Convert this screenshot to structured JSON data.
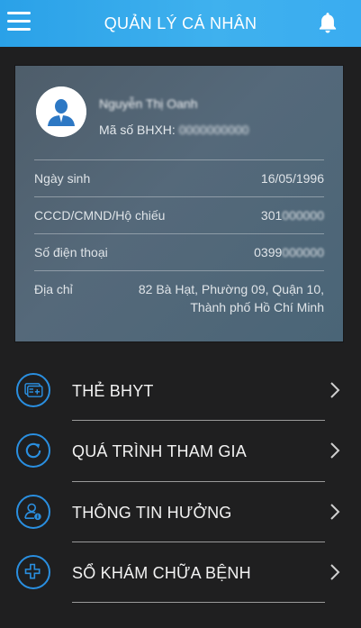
{
  "header": {
    "title": "QUẢN LÝ CÁ NHÂN",
    "menu_icon": "hamburger-icon",
    "bell_icon": "bell-icon",
    "bg": "#3aacf0"
  },
  "profile": {
    "name": "Nguyễn Thị Oanh",
    "bhxh_label": "Mã số BHXH:",
    "bhxh_value": "0000000000",
    "rows": [
      {
        "label": "Ngày sinh",
        "value": "16/05/1996"
      },
      {
        "label": "CCCD/CMND/Hộ chiếu",
        "value_visible": "301",
        "value_hidden": "000000"
      },
      {
        "label": "Số điện thoại",
        "value_visible": "0399",
        "value_hidden": "000000"
      },
      {
        "label": "Địa chỉ",
        "value_line1": "82 Bà Hạt, Phường 09, Quận 10,",
        "value_line2": "Thành phố Hồ Chí Minh"
      }
    ]
  },
  "menu": [
    {
      "label": "THẺ BHYT",
      "icon": "health-card-icon"
    },
    {
      "label": "QUÁ TRÌNH THAM GIA",
      "icon": "history-refresh-icon"
    },
    {
      "label": "THÔNG TIN HƯỞNG",
      "icon": "user-info-icon"
    },
    {
      "label": "SỔ KHÁM CHỮA BỆNH",
      "icon": "medical-cross-icon"
    }
  ],
  "colors": {
    "accent": "#2a8fe0",
    "background": "#1f1f20",
    "card": "#55697a"
  }
}
